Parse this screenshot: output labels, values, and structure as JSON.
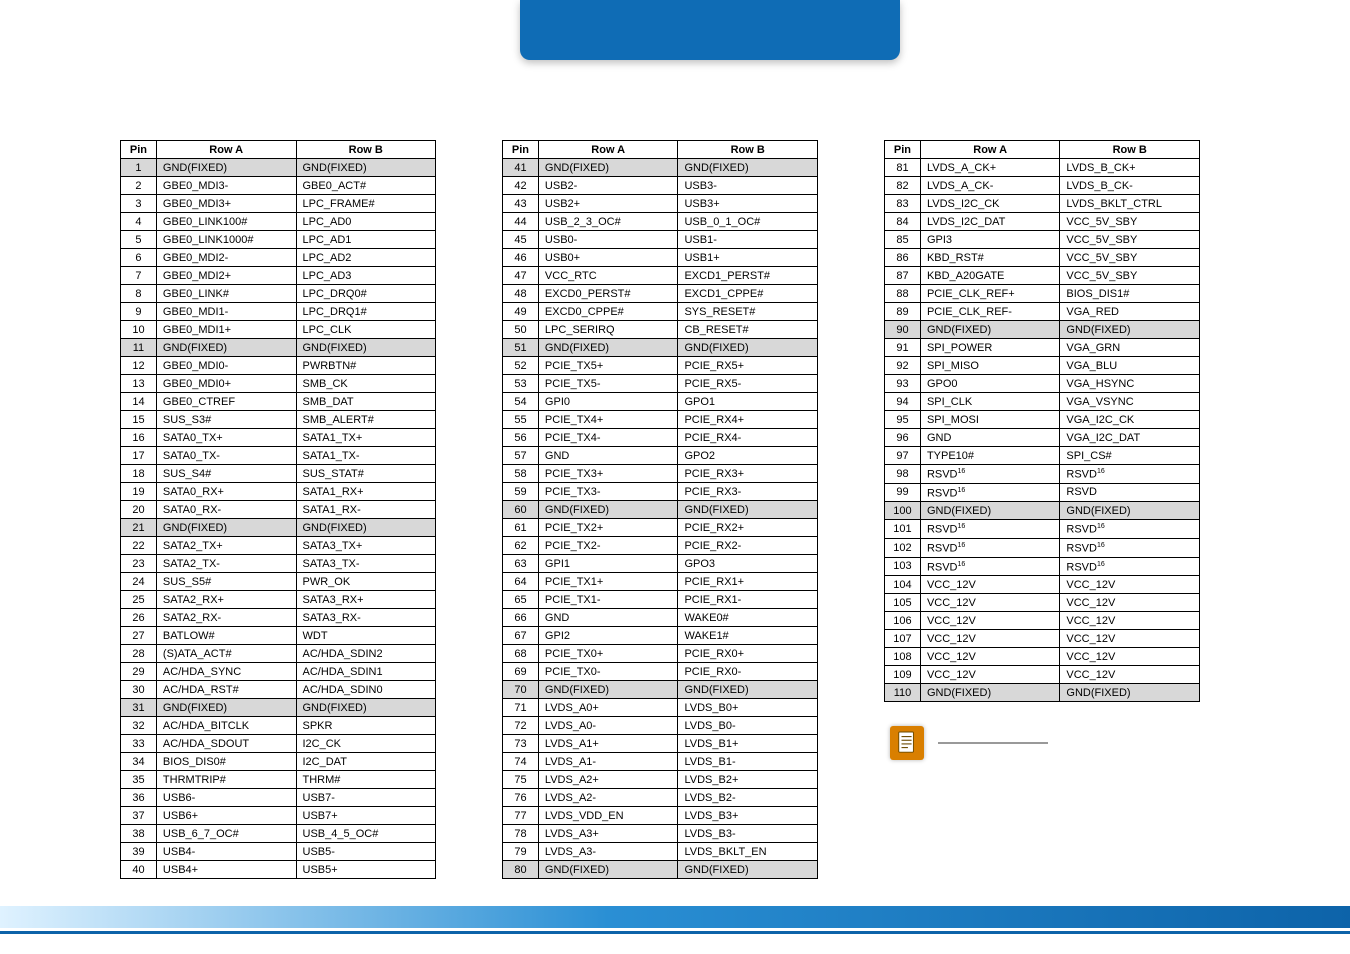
{
  "headers": {
    "pin": "Pin",
    "a": "Row A",
    "b": "Row B"
  },
  "table1": [
    {
      "pin": 1,
      "a": "GND(FIXED)",
      "b": "GND(FIXED)",
      "shaded": true
    },
    {
      "pin": 2,
      "a": "GBE0_MDI3-",
      "b": "GBE0_ACT#"
    },
    {
      "pin": 3,
      "a": "GBE0_MDI3+",
      "b": "LPC_FRAME#"
    },
    {
      "pin": 4,
      "a": "GBE0_LINK100#",
      "b": "LPC_AD0"
    },
    {
      "pin": 5,
      "a": "GBE0_LINK1000#",
      "b": "LPC_AD1"
    },
    {
      "pin": 6,
      "a": "GBE0_MDI2-",
      "b": "LPC_AD2"
    },
    {
      "pin": 7,
      "a": "GBE0_MDI2+",
      "b": "LPC_AD3"
    },
    {
      "pin": 8,
      "a": "GBE0_LINK#",
      "b": "LPC_DRQ0#"
    },
    {
      "pin": 9,
      "a": "GBE0_MDI1-",
      "b": "LPC_DRQ1#"
    },
    {
      "pin": 10,
      "a": "GBE0_MDI1+",
      "b": "LPC_CLK"
    },
    {
      "pin": 11,
      "a": "GND(FIXED)",
      "b": "GND(FIXED)",
      "shaded": true
    },
    {
      "pin": 12,
      "a": "GBE0_MDI0-",
      "b": "PWRBTN#"
    },
    {
      "pin": 13,
      "a": "GBE0_MDI0+",
      "b": "SMB_CK"
    },
    {
      "pin": 14,
      "a": "GBE0_CTREF",
      "b": "SMB_DAT"
    },
    {
      "pin": 15,
      "a": "SUS_S3#",
      "b": "SMB_ALERT#"
    },
    {
      "pin": 16,
      "a": "SATA0_TX+",
      "b": "SATA1_TX+"
    },
    {
      "pin": 17,
      "a": "SATA0_TX-",
      "b": "SATA1_TX-"
    },
    {
      "pin": 18,
      "a": "SUS_S4#",
      "b": "SUS_STAT#"
    },
    {
      "pin": 19,
      "a": "SATA0_RX+",
      "b": "SATA1_RX+"
    },
    {
      "pin": 20,
      "a": "SATA0_RX-",
      "b": "SATA1_RX-"
    },
    {
      "pin": 21,
      "a": "GND(FIXED)",
      "b": "GND(FIXED)",
      "shaded": true
    },
    {
      "pin": 22,
      "a": "SATA2_TX+",
      "b": "SATA3_TX+"
    },
    {
      "pin": 23,
      "a": "SATA2_TX-",
      "b": "SATA3_TX-"
    },
    {
      "pin": 24,
      "a": "SUS_S5#",
      "b": "PWR_OK"
    },
    {
      "pin": 25,
      "a": "SATA2_RX+",
      "b": "SATA3_RX+"
    },
    {
      "pin": 26,
      "a": "SATA2_RX-",
      "b": "SATA3_RX-"
    },
    {
      "pin": 27,
      "a": "BATLOW#",
      "b": "WDT"
    },
    {
      "pin": 28,
      "a": "(S)ATA_ACT#",
      "b": "AC/HDA_SDIN2"
    },
    {
      "pin": 29,
      "a": "AC/HDA_SYNC",
      "b": "AC/HDA_SDIN1"
    },
    {
      "pin": 30,
      "a": "AC/HDA_RST#",
      "b": "AC/HDA_SDIN0"
    },
    {
      "pin": 31,
      "a": "GND(FIXED)",
      "b": "GND(FIXED)",
      "shaded": true
    },
    {
      "pin": 32,
      "a": "AC/HDA_BITCLK",
      "b": "SPKR"
    },
    {
      "pin": 33,
      "a": "AC/HDA_SDOUT",
      "b": "I2C_CK"
    },
    {
      "pin": 34,
      "a": "BIOS_DIS0#",
      "b": "I2C_DAT"
    },
    {
      "pin": 35,
      "a": "THRMTRIP#",
      "b": "THRM#"
    },
    {
      "pin": 36,
      "a": "USB6-",
      "b": "USB7-"
    },
    {
      "pin": 37,
      "a": "USB6+",
      "b": "USB7+"
    },
    {
      "pin": 38,
      "a": "USB_6_7_OC#",
      "b": "USB_4_5_OC#"
    },
    {
      "pin": 39,
      "a": "USB4-",
      "b": "USB5-"
    },
    {
      "pin": 40,
      "a": "USB4+",
      "b": "USB5+"
    }
  ],
  "table2": [
    {
      "pin": 41,
      "a": "GND(FIXED)",
      "b": "GND(FIXED)",
      "shaded": true
    },
    {
      "pin": 42,
      "a": "USB2-",
      "b": "USB3-"
    },
    {
      "pin": 43,
      "a": "USB2+",
      "b": "USB3+"
    },
    {
      "pin": 44,
      "a": "USB_2_3_OC#",
      "b": "USB_0_1_OC#"
    },
    {
      "pin": 45,
      "a": "USB0-",
      "b": "USB1-"
    },
    {
      "pin": 46,
      "a": "USB0+",
      "b": "USB1+"
    },
    {
      "pin": 47,
      "a": "VCC_RTC",
      "b": "EXCD1_PERST#"
    },
    {
      "pin": 48,
      "a": "EXCD0_PERST#",
      "b": "EXCD1_CPPE#"
    },
    {
      "pin": 49,
      "a": "EXCD0_CPPE#",
      "b": "SYS_RESET#"
    },
    {
      "pin": 50,
      "a": "LPC_SERIRQ",
      "b": "CB_RESET#"
    },
    {
      "pin": 51,
      "a": "GND(FIXED)",
      "b": "GND(FIXED)",
      "shaded": true
    },
    {
      "pin": 52,
      "a": "PCIE_TX5+",
      "b": "PCIE_RX5+"
    },
    {
      "pin": 53,
      "a": "PCIE_TX5-",
      "b": "PCIE_RX5-"
    },
    {
      "pin": 54,
      "a": "GPI0",
      "b": "GPO1"
    },
    {
      "pin": 55,
      "a": "PCIE_TX4+",
      "b": "PCIE_RX4+"
    },
    {
      "pin": 56,
      "a": "PCIE_TX4-",
      "b": "PCIE_RX4-"
    },
    {
      "pin": 57,
      "a": "GND",
      "b": "GPO2"
    },
    {
      "pin": 58,
      "a": "PCIE_TX3+",
      "b": "PCIE_RX3+"
    },
    {
      "pin": 59,
      "a": "PCIE_TX3-",
      "b": "PCIE_RX3-"
    },
    {
      "pin": 60,
      "a": "GND(FIXED)",
      "b": "GND(FIXED)",
      "shaded": true
    },
    {
      "pin": 61,
      "a": "PCIE_TX2+",
      "b": "PCIE_RX2+"
    },
    {
      "pin": 62,
      "a": "PCIE_TX2-",
      "b": "PCIE_RX2-"
    },
    {
      "pin": 63,
      "a": "GPI1",
      "b": "GPO3"
    },
    {
      "pin": 64,
      "a": "PCIE_TX1+",
      "b": "PCIE_RX1+"
    },
    {
      "pin": 65,
      "a": "PCIE_TX1-",
      "b": "PCIE_RX1-"
    },
    {
      "pin": 66,
      "a": "GND",
      "b": "WAKE0#"
    },
    {
      "pin": 67,
      "a": "GPI2",
      "b": "WAKE1#"
    },
    {
      "pin": 68,
      "a": "PCIE_TX0+",
      "b": "PCIE_RX0+"
    },
    {
      "pin": 69,
      "a": "PCIE_TX0-",
      "b": "PCIE_RX0-"
    },
    {
      "pin": 70,
      "a": "GND(FIXED)",
      "b": "GND(FIXED)",
      "shaded": true
    },
    {
      "pin": 71,
      "a": "LVDS_A0+",
      "b": "LVDS_B0+"
    },
    {
      "pin": 72,
      "a": "LVDS_A0-",
      "b": "LVDS_B0-"
    },
    {
      "pin": 73,
      "a": "LVDS_A1+",
      "b": "LVDS_B1+"
    },
    {
      "pin": 74,
      "a": "LVDS_A1-",
      "b": "LVDS_B1-"
    },
    {
      "pin": 75,
      "a": "LVDS_A2+",
      "b": "LVDS_B2+"
    },
    {
      "pin": 76,
      "a": "LVDS_A2-",
      "b": "LVDS_B2-"
    },
    {
      "pin": 77,
      "a": "LVDS_VDD_EN",
      "b": "LVDS_B3+"
    },
    {
      "pin": 78,
      "a": "LVDS_A3+",
      "b": "LVDS_B3-"
    },
    {
      "pin": 79,
      "a": "LVDS_A3-",
      "b": "LVDS_BKLT_EN"
    },
    {
      "pin": 80,
      "a": "GND(FIXED)",
      "b": "GND(FIXED)",
      "shaded": true
    }
  ],
  "table3": [
    {
      "pin": 81,
      "a": "LVDS_A_CK+",
      "b": "LVDS_B_CK+"
    },
    {
      "pin": 82,
      "a": "LVDS_A_CK-",
      "b": "LVDS_B_CK-"
    },
    {
      "pin": 83,
      "a": "LVDS_I2C_CK",
      "b": "LVDS_BKLT_CTRL"
    },
    {
      "pin": 84,
      "a": "LVDS_I2C_DAT",
      "b": "VCC_5V_SBY"
    },
    {
      "pin": 85,
      "a": "GPI3",
      "b": "VCC_5V_SBY"
    },
    {
      "pin": 86,
      "a": "KBD_RST#",
      "b": "VCC_5V_SBY"
    },
    {
      "pin": 87,
      "a": "KBD_A20GATE",
      "b": "VCC_5V_SBY"
    },
    {
      "pin": 88,
      "a": "PCIE_CLK_REF+",
      "b": "BIOS_DIS1#"
    },
    {
      "pin": 89,
      "a": "PCIE_CLK_REF-",
      "b": "VGA_RED"
    },
    {
      "pin": 90,
      "a": "GND(FIXED)",
      "b": "GND(FIXED)",
      "shaded": true
    },
    {
      "pin": 91,
      "a": "SPI_POWER",
      "b": "VGA_GRN"
    },
    {
      "pin": 92,
      "a": "SPI_MISO",
      "b": "VGA_BLU"
    },
    {
      "pin": 93,
      "a": "GPO0",
      "b": "VGA_HSYNC"
    },
    {
      "pin": 94,
      "a": "SPI_CLK",
      "b": "VGA_VSYNC"
    },
    {
      "pin": 95,
      "a": "SPI_MOSI",
      "b": "VGA_I2C_CK"
    },
    {
      "pin": 96,
      "a": "GND",
      "b": "VGA_I2C_DAT"
    },
    {
      "pin": 97,
      "a": "TYPE10#",
      "b": "SPI_CS#"
    },
    {
      "pin": 98,
      "a": "RSVD",
      "b": "RSVD",
      "sup": "16"
    },
    {
      "pin": 99,
      "a": "RSVD",
      "b": "RSVD",
      "supA": "16"
    },
    {
      "pin": 100,
      "a": "GND(FIXED)",
      "b": "GND(FIXED)",
      "shaded": true
    },
    {
      "pin": 101,
      "a": "RSVD",
      "b": "RSVD",
      "sup": "16"
    },
    {
      "pin": 102,
      "a": "RSVD",
      "b": "RSVD",
      "sup": "16"
    },
    {
      "pin": 103,
      "a": "RSVD",
      "b": "RSVD",
      "sup": "16"
    },
    {
      "pin": 104,
      "a": "VCC_12V",
      "b": "VCC_12V"
    },
    {
      "pin": 105,
      "a": "VCC_12V",
      "b": "VCC_12V"
    },
    {
      "pin": 106,
      "a": "VCC_12V",
      "b": "VCC_12V"
    },
    {
      "pin": 107,
      "a": "VCC_12V",
      "b": "VCC_12V"
    },
    {
      "pin": 108,
      "a": "VCC_12V",
      "b": "VCC_12V"
    },
    {
      "pin": 109,
      "a": "VCC_12V",
      "b": "VCC_12V"
    },
    {
      "pin": 110,
      "a": "GND(FIXED)",
      "b": "GND(FIXED)",
      "shaded": true
    }
  ]
}
